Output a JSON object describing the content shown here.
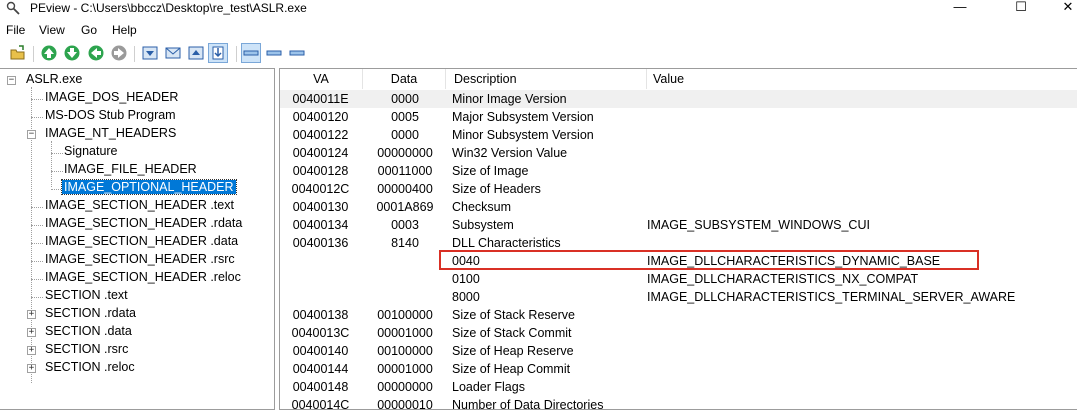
{
  "window": {
    "title": "PEview - C:\\Users\\bbccz\\Desktop\\re_test\\ASLR.exe",
    "minimize": "—",
    "maximize": "☐",
    "close": "✕"
  },
  "menu": {
    "file": "File",
    "view": "View",
    "go": "Go",
    "help": "Help"
  },
  "toolbar": {
    "icons": [
      "open-folder-icon",
      "go-up-icon",
      "go-forward-icon",
      "go-back-icon",
      "go-next-icon",
      "save-icon",
      "mail-icon",
      "export-icon",
      "import-icon",
      "view-bytes-icon",
      "view-words-icon",
      "view-dwords-icon"
    ]
  },
  "tree": {
    "items": [
      {
        "label": "ASLR.exe"
      },
      {
        "label": "IMAGE_DOS_HEADER"
      },
      {
        "label": "MS-DOS Stub Program"
      },
      {
        "label": "IMAGE_NT_HEADERS"
      },
      {
        "label": "Signature"
      },
      {
        "label": "IMAGE_FILE_HEADER"
      },
      {
        "label": "IMAGE_OPTIONAL_HEADER"
      },
      {
        "label": "IMAGE_SECTION_HEADER .text"
      },
      {
        "label": "IMAGE_SECTION_HEADER .rdata"
      },
      {
        "label": "IMAGE_SECTION_HEADER .data"
      },
      {
        "label": "IMAGE_SECTION_HEADER .rsrc"
      },
      {
        "label": "IMAGE_SECTION_HEADER .reloc"
      },
      {
        "label": "SECTION .text"
      },
      {
        "label": "SECTION .rdata"
      },
      {
        "label": "SECTION .data"
      },
      {
        "label": "SECTION .rsrc"
      },
      {
        "label": "SECTION .reloc"
      }
    ],
    "selected": "IMAGE_OPTIONAL_HEADER"
  },
  "table": {
    "columns": {
      "va": "VA",
      "data": "Data",
      "description": "Description",
      "value": "Value"
    },
    "rows": [
      {
        "va": "0040011E",
        "data": "0000",
        "description": "Minor Image Version",
        "value": ""
      },
      {
        "va": "00400120",
        "data": "0005",
        "description": "Major Subsystem Version",
        "value": ""
      },
      {
        "va": "00400122",
        "data": "0000",
        "description": "Minor Subsystem Version",
        "value": ""
      },
      {
        "va": "00400124",
        "data": "00000000",
        "description": "Win32 Version Value",
        "value": ""
      },
      {
        "va": "00400128",
        "data": "00011000",
        "description": "Size of Image",
        "value": ""
      },
      {
        "va": "0040012C",
        "data": "00000400",
        "description": "Size of Headers",
        "value": ""
      },
      {
        "va": "00400130",
        "data": "0001A869",
        "description": "Checksum",
        "value": ""
      },
      {
        "va": "00400134",
        "data": "0003",
        "description": "Subsystem",
        "value": "IMAGE_SUBSYSTEM_WINDOWS_CUI"
      },
      {
        "va": "00400136",
        "data": "8140",
        "description": "DLL Characteristics",
        "value": ""
      },
      {
        "va": "",
        "data": "",
        "description": "0040",
        "value": "IMAGE_DLLCHARACTERISTICS_DYNAMIC_BASE"
      },
      {
        "va": "",
        "data": "",
        "description": "0100",
        "value": "IMAGE_DLLCHARACTERISTICS_NX_COMPAT"
      },
      {
        "va": "",
        "data": "",
        "description": "8000",
        "value": "IMAGE_DLLCHARACTERISTICS_TERMINAL_SERVER_AWARE"
      },
      {
        "va": "00400138",
        "data": "00100000",
        "description": "Size of Stack Reserve",
        "value": ""
      },
      {
        "va": "0040013C",
        "data": "00001000",
        "description": "Size of Stack Commit",
        "value": ""
      },
      {
        "va": "00400140",
        "data": "00100000",
        "description": "Size of Heap Reserve",
        "value": ""
      },
      {
        "va": "00400144",
        "data": "00001000",
        "description": "Size of Heap Commit",
        "value": ""
      },
      {
        "va": "00400148",
        "data": "00000000",
        "description": "Loader Flags",
        "value": ""
      },
      {
        "va": "0040014C",
        "data": "00000010",
        "description": "Number of Data Directories",
        "value": ""
      }
    ]
  },
  "colors": {
    "selection": "#0078d7",
    "highlight_box": "#d93025"
  }
}
